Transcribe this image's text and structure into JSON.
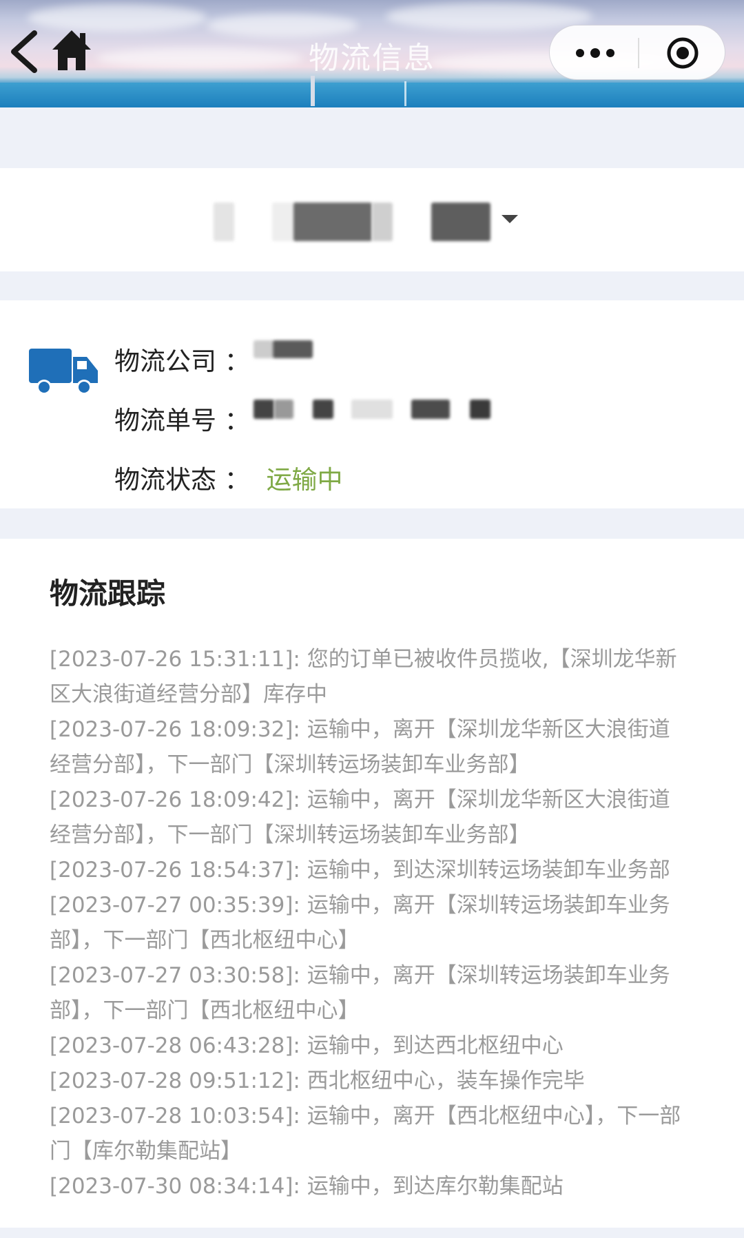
{
  "header": {
    "title": "物流信息"
  },
  "info": {
    "company_label": "物流公司 ：",
    "number_label": "物流单号 ：",
    "status_label": "物流状态 ：",
    "status_value": "运输中"
  },
  "tracking": {
    "title": "物流跟踪",
    "events": [
      "[2023-07-26 15:31:11]: 您的订单已被收件员揽收,【深圳龙华新区大浪街道经营分部】库存中",
      "[2023-07-26 18:09:32]: 运输中，离开【深圳龙华新区大浪街道经营分部】，下一部门【深圳转运场装卸车业务部】",
      "[2023-07-26 18:09:42]: 运输中，离开【深圳龙华新区大浪街道经营分部】，下一部门【深圳转运场装卸车业务部】",
      "[2023-07-26 18:54:37]: 运输中，到达深圳转运场装卸车业务部",
      "[2023-07-27 00:35:39]: 运输中，离开【深圳转运场装卸车业务部】，下一部门【西北枢纽中心】",
      "[2023-07-27 03:30:58]: 运输中，离开【深圳转运场装卸车业务部】，下一部门【西北枢纽中心】",
      "[2023-07-28 06:43:28]: 运输中，到达西北枢纽中心",
      "[2023-07-28 09:51:12]: 西北枢纽中心，装车操作完毕",
      "[2023-07-28 10:03:54]: 运输中，离开【西北枢纽中心】，下一部门【库尔勒集配站】",
      "[2023-07-30 08:34:14]: 运输中，到达库尔勒集配站"
    ]
  },
  "icons": {
    "back": "chevron-left-icon",
    "home": "home-icon",
    "more": "more-dots-icon",
    "close": "target-close-icon",
    "truck": "truck-icon",
    "dropdown": "caret-down-icon"
  },
  "colors": {
    "status_green": "#7fa945",
    "truck_blue": "#1f6fb8",
    "event_gray": "#9a9a9a"
  }
}
